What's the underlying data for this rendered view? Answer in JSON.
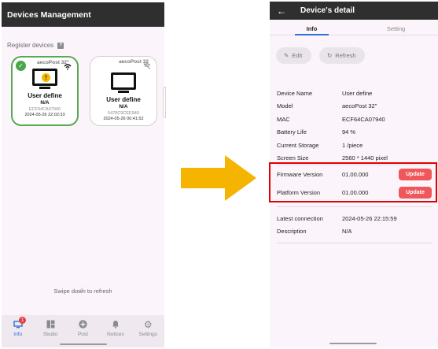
{
  "left": {
    "title": "Devices Management",
    "section_label": "Register devices",
    "help_icon": "?",
    "cards": [
      {
        "model": "aecoPost 32\"",
        "name": "User define",
        "status": "N/A",
        "mac": "ECF64CA07940",
        "date": "2024-05-26 22:02:33",
        "selected": true,
        "warning": true
      },
      {
        "model": "aecoPost 32",
        "name": "User define",
        "status": "N/A",
        "mac": "5478C9CEE949",
        "date": "2024-05-26 00:41:52",
        "selected": false,
        "warning": false
      }
    ],
    "swipe_hint": "Swipe down to refresh",
    "nav": [
      {
        "label": "Info",
        "icon": "monitor-icon",
        "active": true,
        "badge": "1"
      },
      {
        "label": "Studio",
        "icon": "grid-icon",
        "active": false
      },
      {
        "label": "Post",
        "icon": "plus-circle-icon",
        "active": false
      },
      {
        "label": "Notices",
        "icon": "bell-icon",
        "active": false
      },
      {
        "label": "Settings",
        "icon": "gear-icon",
        "active": false
      }
    ]
  },
  "right": {
    "title": "Device's detail",
    "tabs": [
      "Info",
      "Setting"
    ],
    "edit_label": "Edit",
    "refresh_label": "Refresh",
    "details": [
      {
        "label": "Device Name",
        "value": "User define"
      },
      {
        "label": "Model",
        "value": "aecoPost 32\""
      },
      {
        "label": "MAC",
        "value": "ECF64CA07940"
      },
      {
        "label": "Battery Life",
        "value": "94 %"
      },
      {
        "label": "Current Storage",
        "value": "1  /piece"
      },
      {
        "label": "Screen Size",
        "value": "2560 * 1440 pixel"
      }
    ],
    "firmware": {
      "label": "Firmware Version",
      "value": "01.00.000",
      "button": "Update"
    },
    "platform": {
      "label": "Platform Version",
      "value": "01.00.000",
      "button": "Update"
    },
    "latest": {
      "label": "Latest connection",
      "value": "2024-05-26 22:15:59"
    },
    "description": {
      "label": "Description",
      "value": "N/A"
    }
  },
  "colors": {
    "accent": "#2b6fd6",
    "update": "#f0575a",
    "highlight": "#e10000",
    "arrow": "#f5b400",
    "selected_border": "#5aa853"
  }
}
